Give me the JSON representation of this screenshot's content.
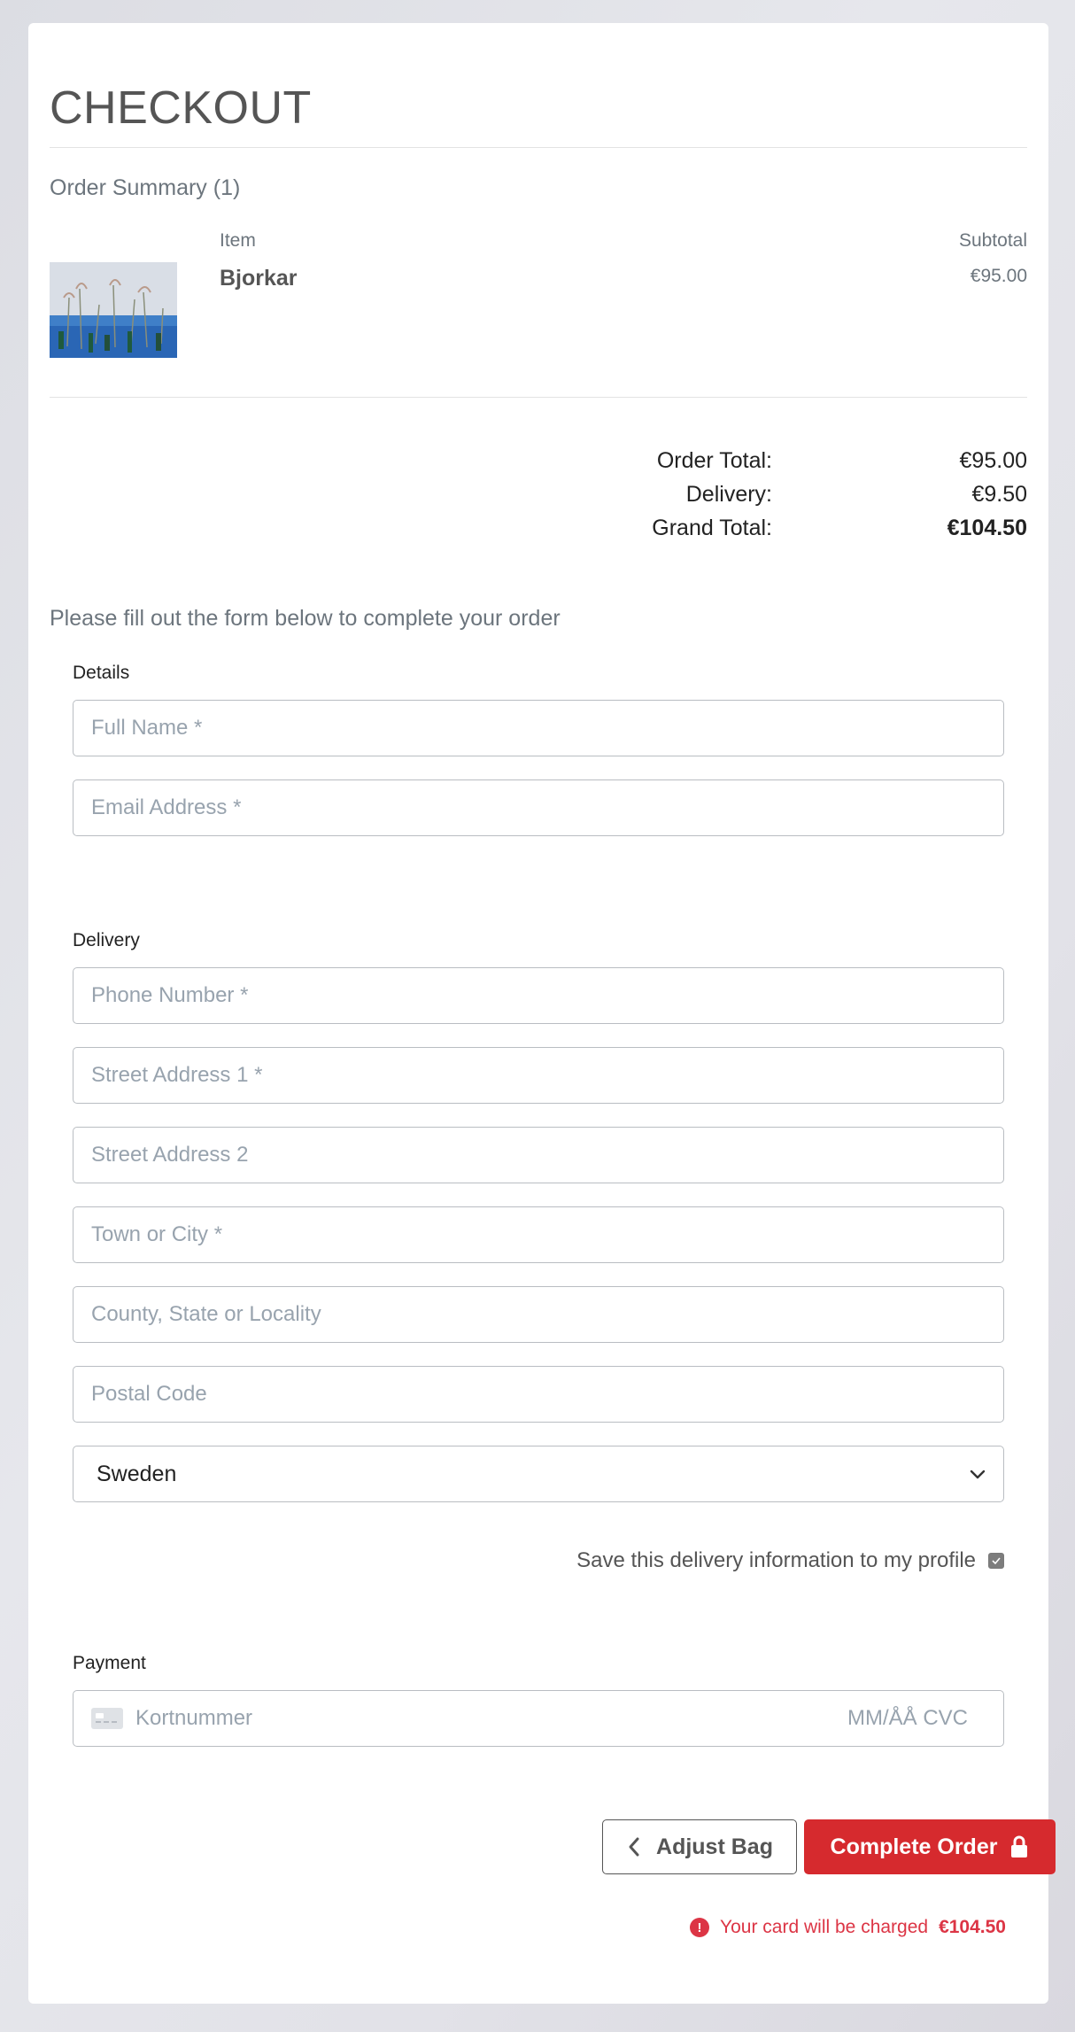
{
  "page": {
    "title": "CHECKOUT"
  },
  "summary": {
    "heading": "Order Summary (1)",
    "col_item": "Item",
    "col_subtotal": "Subtotal",
    "items": [
      {
        "name": "Bjorkar",
        "price": "€95.00"
      }
    ]
  },
  "totals": {
    "order_total_label": "Order Total:",
    "order_total": "€95.00",
    "delivery_label": "Delivery:",
    "delivery": "€9.50",
    "grand_total_label": "Grand Total:",
    "grand_total": "€104.50"
  },
  "form": {
    "note": "Please fill out the form below to complete your order",
    "details_label": "Details",
    "full_name_ph": "Full Name *",
    "email_ph": "Email Address *",
    "delivery_label": "Delivery",
    "phone_ph": "Phone Number *",
    "street1_ph": "Street Address 1 *",
    "street2_ph": "Street Address 2",
    "town_ph": "Town or City *",
    "county_ph": "County, State or Locality",
    "postcode_ph": "Postal Code",
    "country_value": "Sweden",
    "save_label": "Save this delivery information to my profile",
    "save_checked": true,
    "payment_label": "Payment",
    "card_ph": "Kortnummer",
    "card_exp_ph": "MM/ÅÅ CVC"
  },
  "actions": {
    "adjust_bag": "Adjust Bag",
    "complete_order": "Complete Order",
    "charge_text": "Your card will be charged",
    "charge_amount": "€104.50"
  },
  "colors": {
    "accent": "#d62a2e",
    "warning": "#dc3545"
  }
}
